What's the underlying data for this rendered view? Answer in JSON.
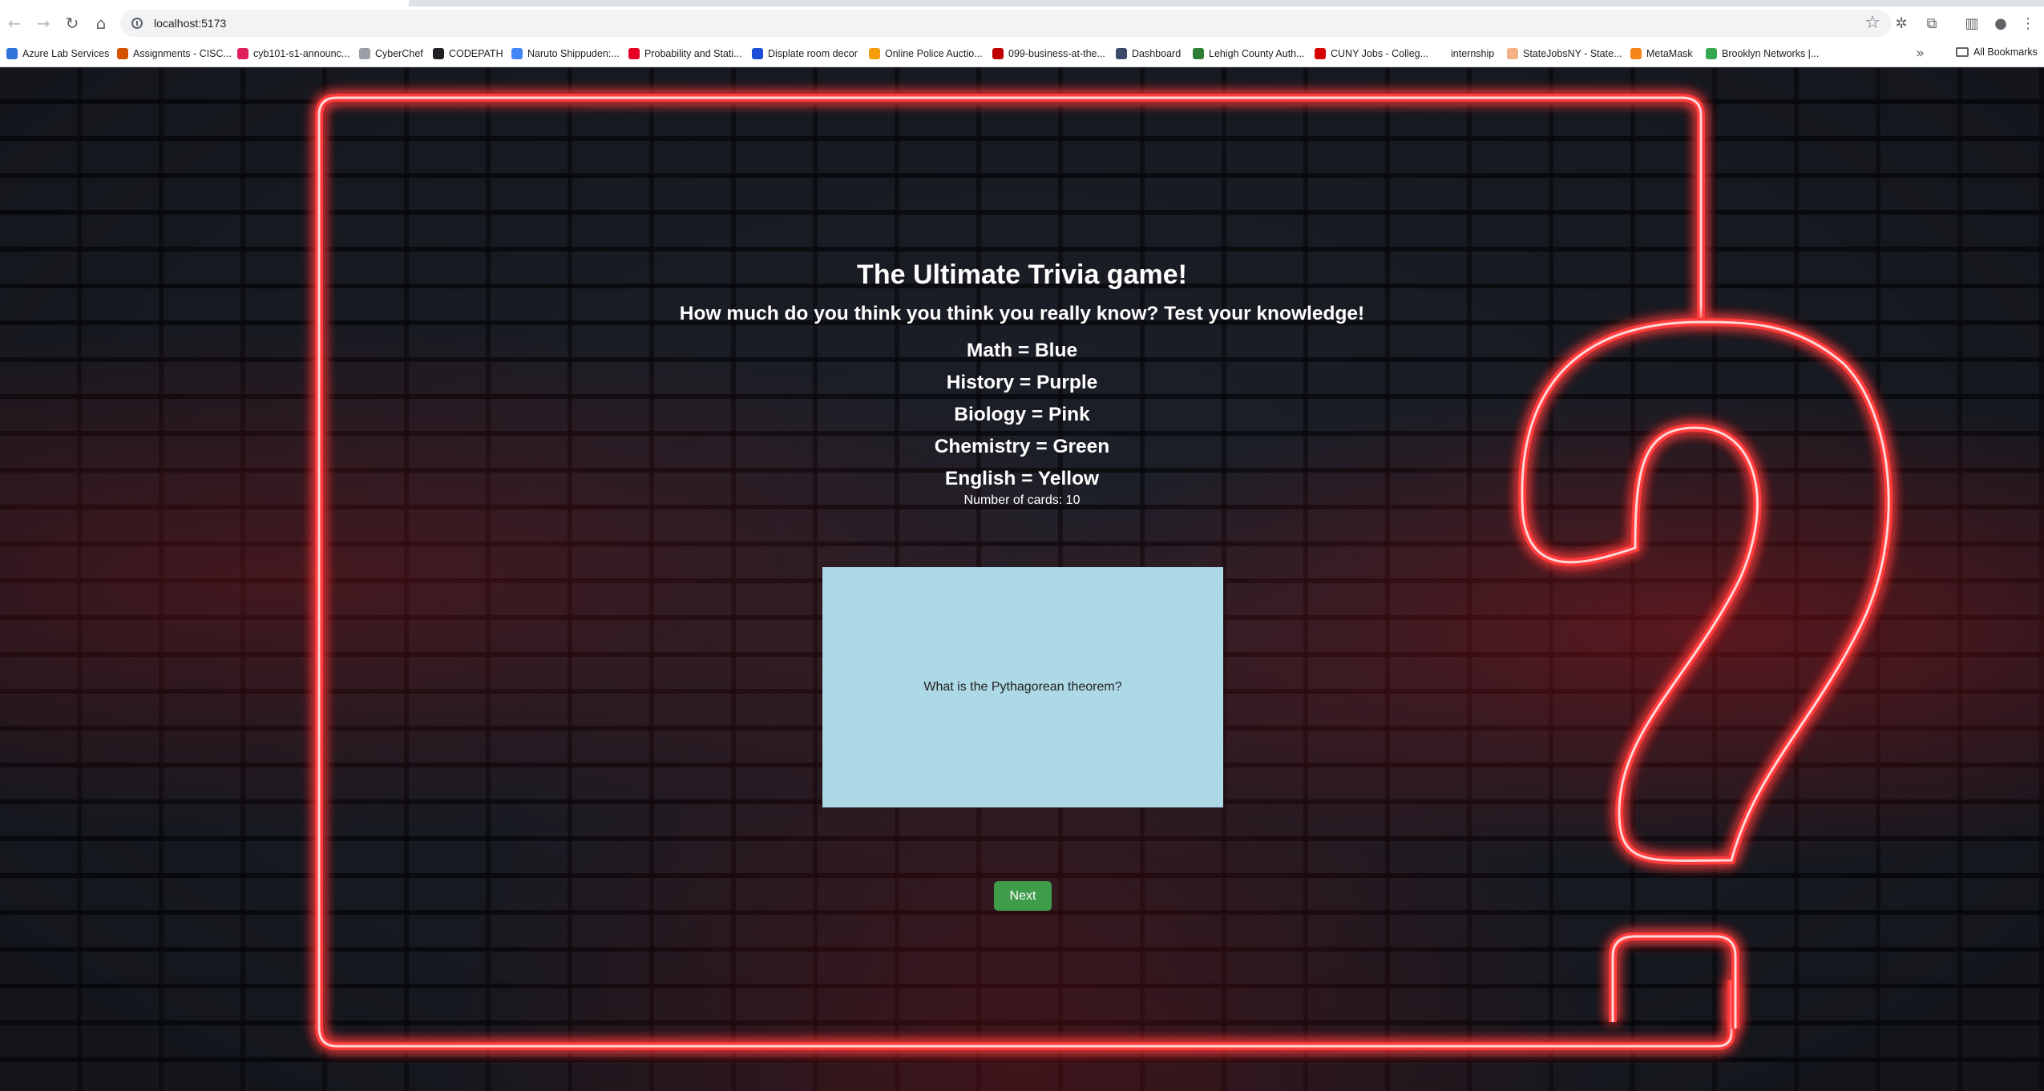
{
  "browser": {
    "url": "localhost:5173",
    "bookmarks": [
      {
        "label": "Azure Lab Services",
        "color": "#2f73d8"
      },
      {
        "label": "Assignments - CISC...",
        "color": "#d35400"
      },
      {
        "label": "cyb101-s1-announc...",
        "color": "#e01e5a"
      },
      {
        "label": "CyberChef",
        "color": "#9aa0a6"
      },
      {
        "label": "CODEPATH",
        "color": "#202124"
      },
      {
        "label": "Naruto Shippuden:...",
        "color": "#4285f4"
      },
      {
        "label": "Probability and Stati...",
        "color": "#e60023"
      },
      {
        "label": "Displate room decor",
        "color": "#1d4ed8"
      },
      {
        "label": "Online Police Auctio...",
        "color": "#f59e0b"
      },
      {
        "label": "099-business-at-the...",
        "color": "#c00000"
      },
      {
        "label": "Dashboard",
        "color": "#3b4a6b"
      },
      {
        "label": "Lehigh County Auth...",
        "color": "#2e7d32"
      },
      {
        "label": "CUNY Jobs - Colleg...",
        "color": "#d50000"
      },
      {
        "label": "internship",
        "color": "#ffffff"
      },
      {
        "label": "StateJobsNY - State...",
        "color": "#f4b183"
      },
      {
        "label": "MetaMask",
        "color": "#f6851b"
      },
      {
        "label": "Brooklyn Networks |...",
        "color": "#34a853"
      }
    ],
    "all_bookmarks": "All Bookmarks"
  },
  "page": {
    "title": "The Ultimate Trivia game!",
    "subtitle": "How much do you think you think you really know? Test your knowledge!",
    "legend": [
      "Math = Blue",
      "History = Purple",
      "Biology = Pink",
      "Chemistry = Green",
      "English = Yellow"
    ],
    "card_count": "Number of cards: 10",
    "card_text": "What is the Pythagorean theorem?",
    "card_color": "#add8e6",
    "next_label": "Next",
    "next_color": "#3e9c4a",
    "neon_color": "#ff2a2a"
  }
}
